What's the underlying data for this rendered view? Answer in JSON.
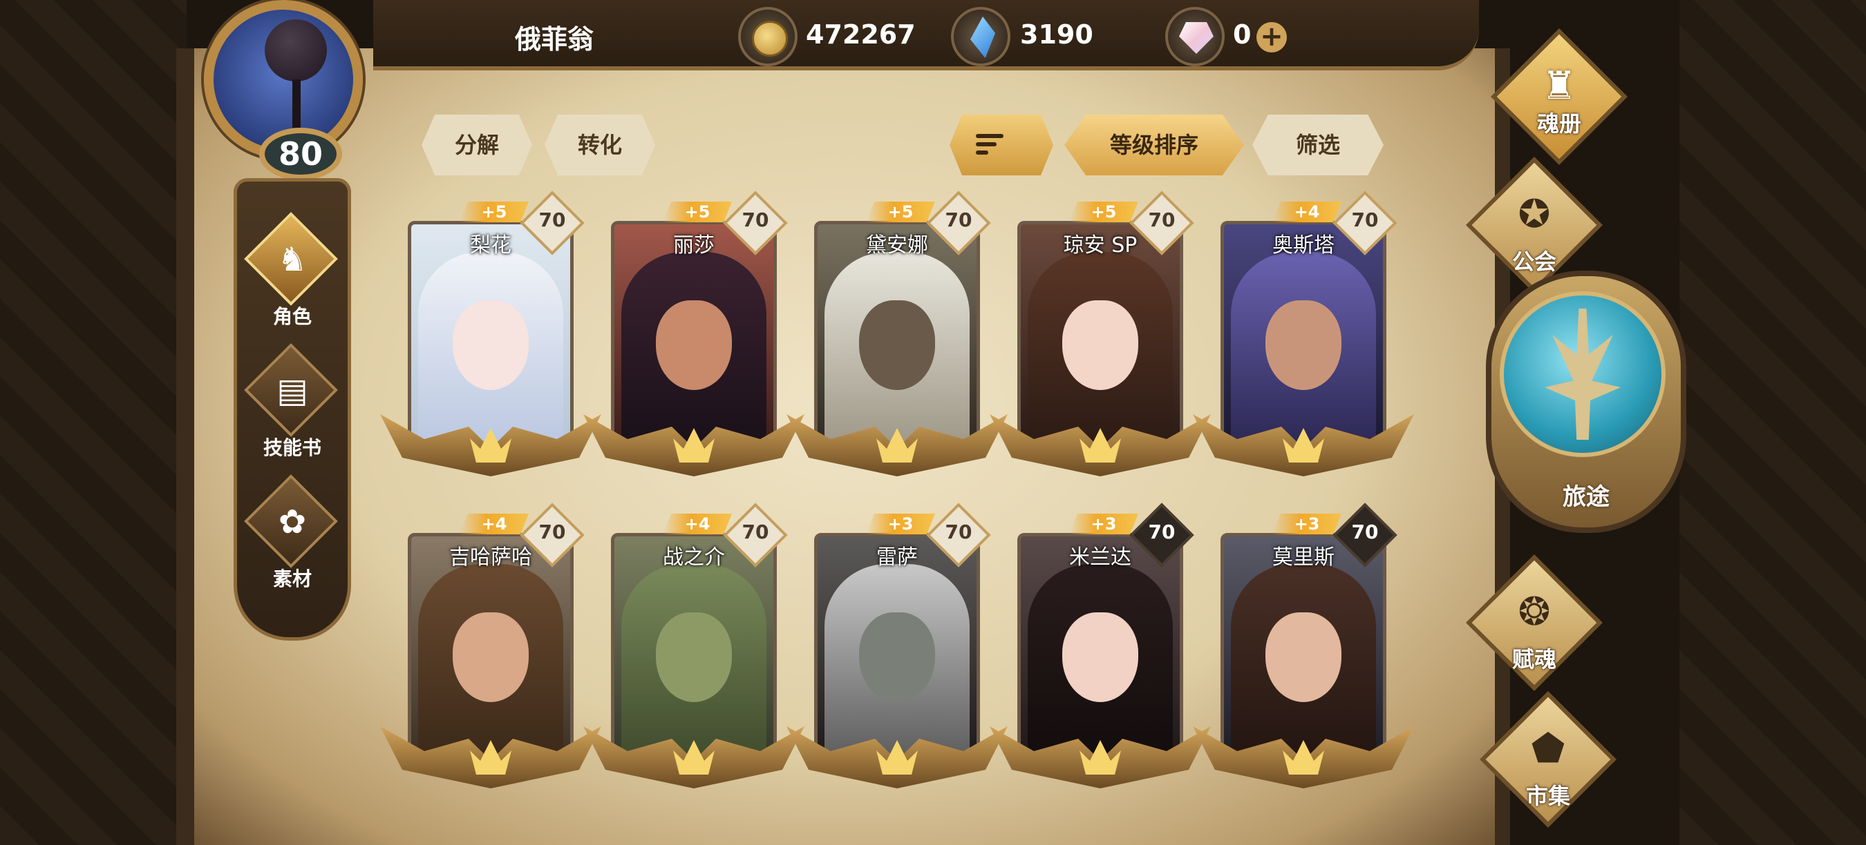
{
  "player": {
    "name": "俄菲翁",
    "level": "80"
  },
  "currencies": {
    "gold": "472267",
    "crystal": "3190",
    "gem": "0",
    "add_symbol": "+"
  },
  "left_nav": [
    {
      "label": "角色",
      "icon": "character-icon"
    },
    {
      "label": "技能书",
      "icon": "skill-book-icon"
    },
    {
      "label": "素材",
      "icon": "material-icon"
    }
  ],
  "actions": {
    "decompose": "分解",
    "convert": "转化",
    "sort_by_level": "等级排序",
    "filter": "筛选"
  },
  "characters": [
    {
      "name": "梨花",
      "stars": "+5",
      "level": "70"
    },
    {
      "name": "丽莎",
      "stars": "+5",
      "level": "70"
    },
    {
      "name": "黛安娜",
      "stars": "+5",
      "level": "70"
    },
    {
      "name": "琼安 SP",
      "stars": "+5",
      "level": "70"
    },
    {
      "name": "奥斯塔",
      "stars": "+4",
      "level": "70"
    },
    {
      "name": "吉哈萨哈",
      "stars": "+4",
      "level": "70"
    },
    {
      "name": "战之介",
      "stars": "+4",
      "level": "70"
    },
    {
      "name": "雷萨",
      "stars": "+3",
      "level": "70"
    },
    {
      "name": "米兰达",
      "stars": "+3",
      "level": "70"
    },
    {
      "name": "莫里斯",
      "stars": "+3",
      "level": "70"
    }
  ],
  "right_nav": {
    "soul_book": "魂册",
    "guild": "公会",
    "journey": "旅途",
    "soul_gift": "赋魂",
    "market": "市集"
  },
  "colors": {
    "accent_gold": "#f1a92a",
    "parchment": "#e0cfa6",
    "frame_brown": "#3b2c1c"
  }
}
